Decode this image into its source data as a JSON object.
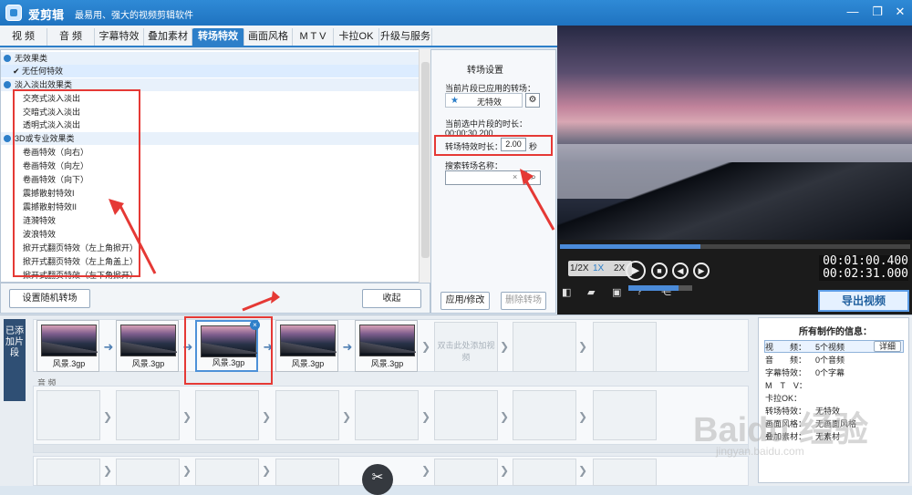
{
  "titlebar": {
    "app_name": "爱剪辑",
    "slogan": "最易用、强大的视频剪辑软件"
  },
  "tabs": [
    "视 频",
    "音 频",
    "字幕特效",
    "叠加素材",
    "转场特效",
    "画面风格",
    "M T V",
    "卡拉OK",
    "升级与服务"
  ],
  "effect_list": {
    "rows": [
      {
        "label": "无效果类",
        "type": "category"
      },
      {
        "label": "✔ 无任何特效",
        "type": "selected"
      },
      {
        "label": "淡入淡出效果类",
        "type": "category"
      },
      {
        "label": "交亮式淡入淡出",
        "type": "item"
      },
      {
        "label": "交暗式淡入淡出",
        "type": "item"
      },
      {
        "label": "透明式淡入淡出",
        "type": "item"
      },
      {
        "label": "3D或专业效果类",
        "type": "category"
      },
      {
        "label": "卷画特效（向右）",
        "type": "item"
      },
      {
        "label": "卷画特效（向左）",
        "type": "item"
      },
      {
        "label": "卷画特效（向下）",
        "type": "item"
      },
      {
        "label": "震撼散射特效I",
        "type": "item"
      },
      {
        "label": "震撼散射特效II",
        "type": "item"
      },
      {
        "label": "涟漪特效",
        "type": "item"
      },
      {
        "label": "波浪特效",
        "type": "item"
      },
      {
        "label": "掀开式翻页特效（左上角掀开）",
        "type": "item"
      },
      {
        "label": "掀开式翻页特效（左上角盖上）",
        "type": "item"
      },
      {
        "label": "掀开式翻页特效（左下角掀开）",
        "type": "item"
      }
    ]
  },
  "bottom_controls": {
    "random": "设置随机转场",
    "collapse": "收起"
  },
  "transition_settings": {
    "title": "转场设置",
    "applied_label": "当前片段已应用的转场：",
    "applied_value": "无特效",
    "duration_current_label": "当前选中片段的时长：",
    "duration_current_value": "00:00:30.200",
    "effect_duration_label": "转场特效时长：",
    "effect_duration_value": "2.00",
    "effect_duration_unit": "秒",
    "search_label": "搜索转场名称：",
    "apply_button": "应用/修改",
    "delete_button": "删除转场"
  },
  "player": {
    "speed_options": [
      "1/2X",
      "1X",
      "2X"
    ],
    "time_current": "00:01:00.400",
    "time_total": "00:02:31.000",
    "export_button": "导出视频"
  },
  "timeline": {
    "side_tab": "已添加片段",
    "clips": [
      "风景.3gp",
      "风景.3gp",
      "风景.3gp",
      "风景.3gp",
      "风景.3gp"
    ],
    "add_hint": "双击此处添加视频",
    "audio_label": "音 频"
  },
  "info_panel": {
    "title": "所有制作的信息：",
    "detail_button": "详细",
    "rows": [
      {
        "k": "视　　频：",
        "v": "5个视频"
      },
      {
        "k": "音　　频：",
        "v": "0个音频"
      },
      {
        "k": "字幕特效：",
        "v": "0个字幕"
      },
      {
        "k": "M　T　V：",
        "v": ""
      },
      {
        "k": "卡拉OK：",
        "v": ""
      },
      {
        "k": "转场特效：",
        "v": "无特效"
      },
      {
        "k": "画面风格：",
        "v": "无画面风格"
      },
      {
        "k": "叠加素材：",
        "v": "无素材"
      }
    ]
  },
  "watermark": {
    "text": "Baidu 经验",
    "url": "jingyan.baidu.com"
  }
}
